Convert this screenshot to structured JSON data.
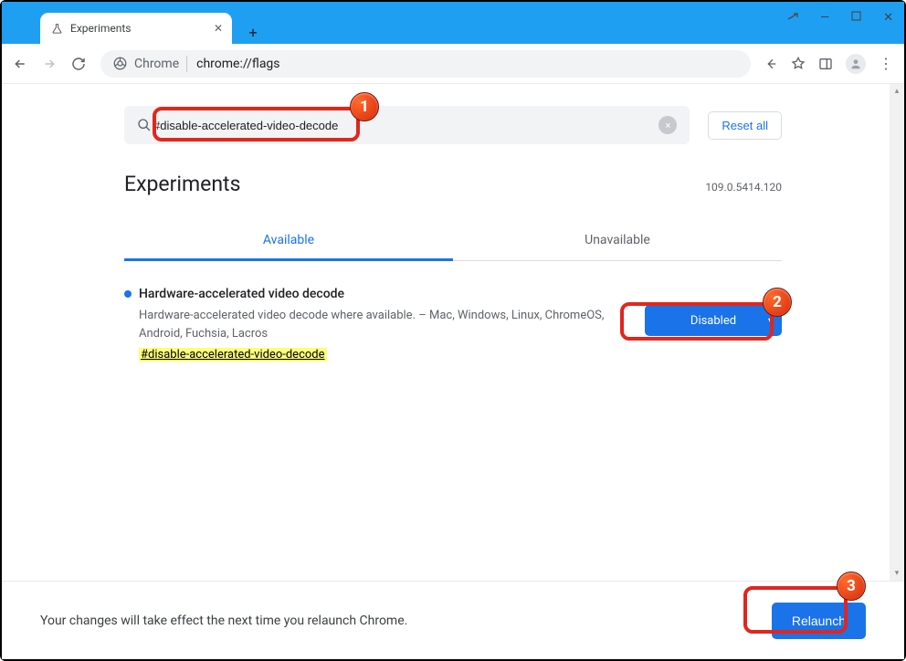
{
  "window": {
    "tab_title": "Experiments",
    "tab_icon": "flask-icon",
    "minimize": "—",
    "maximize": "▢",
    "close": "✕",
    "new_tab": "+"
  },
  "toolbar": {
    "omnibox": {
      "security_label": "Chrome",
      "url": "chrome://flags"
    }
  },
  "search": {
    "value": "#disable-accelerated-video-decode",
    "clear_icon": "×"
  },
  "reset_label": "Reset all",
  "heading": "Experiments",
  "version": "109.0.5414.120",
  "page_tabs": {
    "available": "Available",
    "unavailable": "Unavailable"
  },
  "flag": {
    "title": "Hardware-accelerated video decode",
    "description": "Hardware-accelerated video decode where available. – Mac, Windows, Linux, ChromeOS, Android, Fuchsia, Lacros",
    "tag": "#disable-accelerated-video-decode",
    "select_value": "Disabled"
  },
  "footer": {
    "message": "Your changes will take effect the next time you relaunch Chrome.",
    "relaunch": "Relaunch"
  },
  "annotations": [
    "1",
    "2",
    "3"
  ]
}
